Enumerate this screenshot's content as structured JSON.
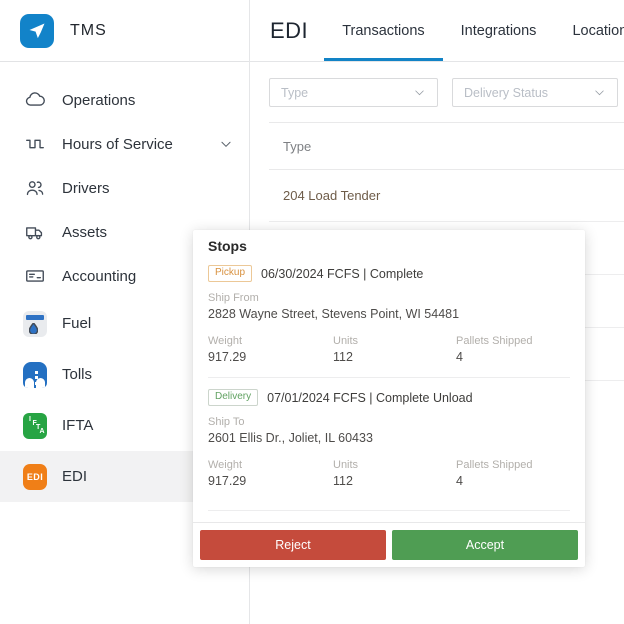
{
  "app": {
    "logo_text": "TMS"
  },
  "sidebar": {
    "items": [
      {
        "label": "Operations",
        "icon": "cloud-icon"
      },
      {
        "label": "Hours of Service",
        "icon": "waveform-icon",
        "expandable": true
      },
      {
        "label": "Drivers",
        "icon": "people-icon"
      },
      {
        "label": "Assets",
        "icon": "truck-icon"
      },
      {
        "label": "Accounting",
        "icon": "invoice-icon"
      },
      {
        "label": "Fuel",
        "icon": "fuel-icon"
      },
      {
        "label": "Tolls",
        "icon": "tolls-bridge-icon"
      },
      {
        "label": "IFTA",
        "icon": "ifta-icon"
      },
      {
        "label": "EDI",
        "icon": "edi-icon",
        "active": true
      }
    ]
  },
  "header": {
    "title": "EDI",
    "tabs": [
      {
        "label": "Transactions",
        "active": true
      },
      {
        "label": "Integrations",
        "active": false
      },
      {
        "label": "Locations",
        "active": false
      }
    ]
  },
  "filters": {
    "type_placeholder": "Type",
    "delivery_status_placeholder": "Delivery Status"
  },
  "table": {
    "column_header": "Type",
    "rows": [
      {
        "type": "204 Load Tender"
      }
    ]
  },
  "popup": {
    "title": "Stops",
    "stops": [
      {
        "badge": "Pickup",
        "schedule": "06/30/2024 FCFS | Complete",
        "address_label": "Ship From",
        "address": "2828 Wayne Street, Stevens Point, WI 54481",
        "weight_label": "Weight",
        "weight": "917.29",
        "units_label": "Units",
        "units": "112",
        "pallets_label": "Pallets Shipped",
        "pallets": "4"
      },
      {
        "badge": "Delivery",
        "schedule": "07/01/2024 FCFS | Complete Unload",
        "address_label": "Ship To",
        "address": "2601 Ellis Dr., Joliet, IL 60433",
        "weight_label": "Weight",
        "weight": "917.29",
        "units_label": "Units",
        "units": "112",
        "pallets_label": "Pallets Shipped",
        "pallets": "4"
      }
    ],
    "actions": {
      "reject": "Reject",
      "accept": "Accept"
    }
  },
  "icons": {
    "ifta_letters": [
      "I",
      "F",
      "T",
      "A"
    ],
    "edi_text": "EDI"
  },
  "colors": {
    "accent_blue": "#1283c6",
    "logo_blue": "#1283c9",
    "pickup_orange": "#d8913f",
    "delivery_green": "#61a262",
    "reject_red": "#c54b3c",
    "accept_green": "#4f9d53",
    "fuel_icon_blue": "#2e72c4",
    "tolls_icon_blue": "#2470c2",
    "ifta_icon_green": "#27a443",
    "edi_icon_orange": "#f07f17"
  }
}
